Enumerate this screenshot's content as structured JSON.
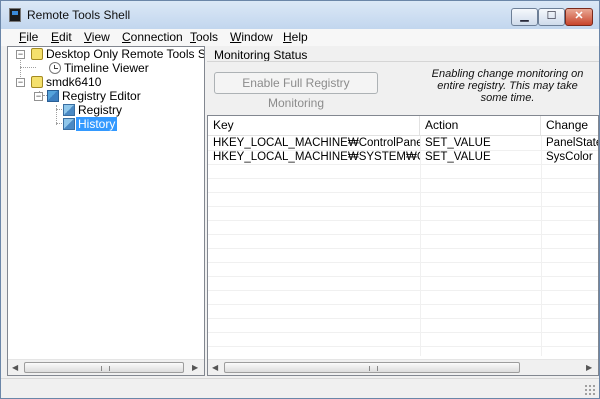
{
  "window": {
    "title": "Remote Tools Shell",
    "app_icon": "terminal-icon"
  },
  "caption_buttons": {
    "minimize": "▁",
    "maximize": "☐",
    "close": "✕"
  },
  "menu": [
    {
      "label": "File",
      "u": "F",
      "rest": "ile"
    },
    {
      "label": "Edit",
      "u": "E",
      "rest": "dit"
    },
    {
      "label": "View",
      "u": "V",
      "rest": "iew"
    },
    {
      "label": "Connection",
      "u": "C",
      "rest": "onnection"
    },
    {
      "label": "Tools",
      "u": "T",
      "rest": "ools"
    },
    {
      "label": "Window",
      "u": "W",
      "rest": "indow"
    },
    {
      "label": "Help",
      "u": "H",
      "rest": "elp"
    }
  ],
  "tree": {
    "nodes": [
      {
        "label": "Desktop Only Remote Tools Shell",
        "icon": "device-icon",
        "expander": "−"
      },
      {
        "label": "Timeline Viewer",
        "icon": "clock-icon"
      },
      {
        "label": "smdk6410",
        "icon": "device-icon",
        "expander": "−"
      },
      {
        "label": "Registry Editor",
        "icon": "registry-icon",
        "expander": "−"
      },
      {
        "label": "Registry",
        "icon": "registry-icon"
      },
      {
        "label": "History",
        "icon": "registry-icon",
        "selected": true
      }
    ]
  },
  "monitoring": {
    "header": "Monitoring Status",
    "enable_button": "Enable Full Registry Monitoring",
    "info_text": "Enabling change monitoring on entire registry. This may take some time."
  },
  "list": {
    "columns": [
      "Key",
      "Action",
      "Change"
    ],
    "rows": [
      [
        "HKEY_LOCAL_MACHINE₩ControlPanel",
        "SET_VALUE",
        "PanelState"
      ],
      [
        "HKEY_LOCAL_MACHINE₩SYSTEM₩GWE",
        "SET_VALUE",
        "SysColor"
      ]
    ]
  },
  "colors": {
    "selection": "#3399ff",
    "titlebar": "#c2d6ee"
  }
}
